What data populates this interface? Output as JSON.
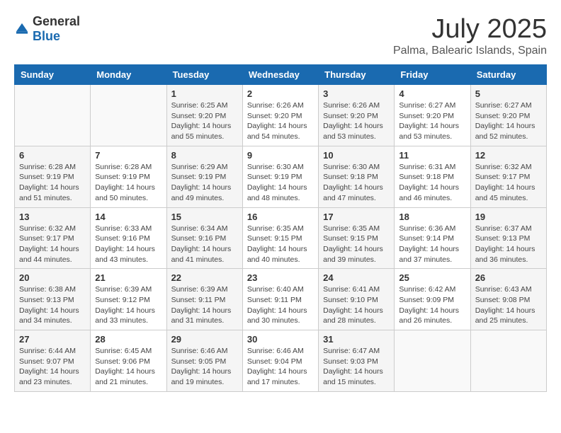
{
  "header": {
    "logo_general": "General",
    "logo_blue": "Blue",
    "month": "July 2025",
    "location": "Palma, Balearic Islands, Spain"
  },
  "days_of_week": [
    "Sunday",
    "Monday",
    "Tuesday",
    "Wednesday",
    "Thursday",
    "Friday",
    "Saturday"
  ],
  "weeks": [
    [
      {
        "day": "",
        "sunrise": "",
        "sunset": "",
        "daylight": ""
      },
      {
        "day": "",
        "sunrise": "",
        "sunset": "",
        "daylight": ""
      },
      {
        "day": "1",
        "sunrise": "Sunrise: 6:25 AM",
        "sunset": "Sunset: 9:20 PM",
        "daylight": "Daylight: 14 hours and 55 minutes."
      },
      {
        "day": "2",
        "sunrise": "Sunrise: 6:26 AM",
        "sunset": "Sunset: 9:20 PM",
        "daylight": "Daylight: 14 hours and 54 minutes."
      },
      {
        "day": "3",
        "sunrise": "Sunrise: 6:26 AM",
        "sunset": "Sunset: 9:20 PM",
        "daylight": "Daylight: 14 hours and 53 minutes."
      },
      {
        "day": "4",
        "sunrise": "Sunrise: 6:27 AM",
        "sunset": "Sunset: 9:20 PM",
        "daylight": "Daylight: 14 hours and 53 minutes."
      },
      {
        "day": "5",
        "sunrise": "Sunrise: 6:27 AM",
        "sunset": "Sunset: 9:20 PM",
        "daylight": "Daylight: 14 hours and 52 minutes."
      }
    ],
    [
      {
        "day": "6",
        "sunrise": "Sunrise: 6:28 AM",
        "sunset": "Sunset: 9:19 PM",
        "daylight": "Daylight: 14 hours and 51 minutes."
      },
      {
        "day": "7",
        "sunrise": "Sunrise: 6:28 AM",
        "sunset": "Sunset: 9:19 PM",
        "daylight": "Daylight: 14 hours and 50 minutes."
      },
      {
        "day": "8",
        "sunrise": "Sunrise: 6:29 AM",
        "sunset": "Sunset: 9:19 PM",
        "daylight": "Daylight: 14 hours and 49 minutes."
      },
      {
        "day": "9",
        "sunrise": "Sunrise: 6:30 AM",
        "sunset": "Sunset: 9:19 PM",
        "daylight": "Daylight: 14 hours and 48 minutes."
      },
      {
        "day": "10",
        "sunrise": "Sunrise: 6:30 AM",
        "sunset": "Sunset: 9:18 PM",
        "daylight": "Daylight: 14 hours and 47 minutes."
      },
      {
        "day": "11",
        "sunrise": "Sunrise: 6:31 AM",
        "sunset": "Sunset: 9:18 PM",
        "daylight": "Daylight: 14 hours and 46 minutes."
      },
      {
        "day": "12",
        "sunrise": "Sunrise: 6:32 AM",
        "sunset": "Sunset: 9:17 PM",
        "daylight": "Daylight: 14 hours and 45 minutes."
      }
    ],
    [
      {
        "day": "13",
        "sunrise": "Sunrise: 6:32 AM",
        "sunset": "Sunset: 9:17 PM",
        "daylight": "Daylight: 14 hours and 44 minutes."
      },
      {
        "day": "14",
        "sunrise": "Sunrise: 6:33 AM",
        "sunset": "Sunset: 9:16 PM",
        "daylight": "Daylight: 14 hours and 43 minutes."
      },
      {
        "day": "15",
        "sunrise": "Sunrise: 6:34 AM",
        "sunset": "Sunset: 9:16 PM",
        "daylight": "Daylight: 14 hours and 41 minutes."
      },
      {
        "day": "16",
        "sunrise": "Sunrise: 6:35 AM",
        "sunset": "Sunset: 9:15 PM",
        "daylight": "Daylight: 14 hours and 40 minutes."
      },
      {
        "day": "17",
        "sunrise": "Sunrise: 6:35 AM",
        "sunset": "Sunset: 9:15 PM",
        "daylight": "Daylight: 14 hours and 39 minutes."
      },
      {
        "day": "18",
        "sunrise": "Sunrise: 6:36 AM",
        "sunset": "Sunset: 9:14 PM",
        "daylight": "Daylight: 14 hours and 37 minutes."
      },
      {
        "day": "19",
        "sunrise": "Sunrise: 6:37 AM",
        "sunset": "Sunset: 9:13 PM",
        "daylight": "Daylight: 14 hours and 36 minutes."
      }
    ],
    [
      {
        "day": "20",
        "sunrise": "Sunrise: 6:38 AM",
        "sunset": "Sunset: 9:13 PM",
        "daylight": "Daylight: 14 hours and 34 minutes."
      },
      {
        "day": "21",
        "sunrise": "Sunrise: 6:39 AM",
        "sunset": "Sunset: 9:12 PM",
        "daylight": "Daylight: 14 hours and 33 minutes."
      },
      {
        "day": "22",
        "sunrise": "Sunrise: 6:39 AM",
        "sunset": "Sunset: 9:11 PM",
        "daylight": "Daylight: 14 hours and 31 minutes."
      },
      {
        "day": "23",
        "sunrise": "Sunrise: 6:40 AM",
        "sunset": "Sunset: 9:11 PM",
        "daylight": "Daylight: 14 hours and 30 minutes."
      },
      {
        "day": "24",
        "sunrise": "Sunrise: 6:41 AM",
        "sunset": "Sunset: 9:10 PM",
        "daylight": "Daylight: 14 hours and 28 minutes."
      },
      {
        "day": "25",
        "sunrise": "Sunrise: 6:42 AM",
        "sunset": "Sunset: 9:09 PM",
        "daylight": "Daylight: 14 hours and 26 minutes."
      },
      {
        "day": "26",
        "sunrise": "Sunrise: 6:43 AM",
        "sunset": "Sunset: 9:08 PM",
        "daylight": "Daylight: 14 hours and 25 minutes."
      }
    ],
    [
      {
        "day": "27",
        "sunrise": "Sunrise: 6:44 AM",
        "sunset": "Sunset: 9:07 PM",
        "daylight": "Daylight: 14 hours and 23 minutes."
      },
      {
        "day": "28",
        "sunrise": "Sunrise: 6:45 AM",
        "sunset": "Sunset: 9:06 PM",
        "daylight": "Daylight: 14 hours and 21 minutes."
      },
      {
        "day": "29",
        "sunrise": "Sunrise: 6:46 AM",
        "sunset": "Sunset: 9:05 PM",
        "daylight": "Daylight: 14 hours and 19 minutes."
      },
      {
        "day": "30",
        "sunrise": "Sunrise: 6:46 AM",
        "sunset": "Sunset: 9:04 PM",
        "daylight": "Daylight: 14 hours and 17 minutes."
      },
      {
        "day": "31",
        "sunrise": "Sunrise: 6:47 AM",
        "sunset": "Sunset: 9:03 PM",
        "daylight": "Daylight: 14 hours and 15 minutes."
      },
      {
        "day": "",
        "sunrise": "",
        "sunset": "",
        "daylight": ""
      },
      {
        "day": "",
        "sunrise": "",
        "sunset": "",
        "daylight": ""
      }
    ]
  ]
}
